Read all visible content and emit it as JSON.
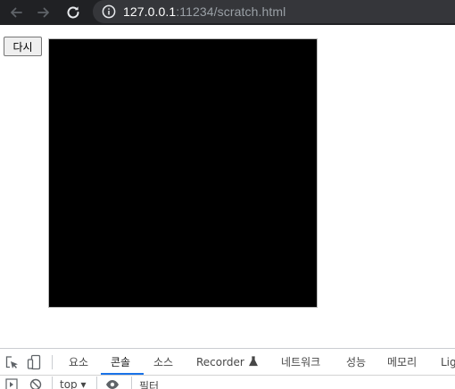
{
  "browser": {
    "url_host": "127.0.0.1",
    "url_rest": ":11234/scratch.html"
  },
  "page": {
    "retry_label": "다시"
  },
  "devtools": {
    "tabs": [
      "요소",
      "콘솔",
      "소스",
      "Recorder",
      "네트워크",
      "성능",
      "메모리",
      "Lig"
    ],
    "active_tab": "콘솔",
    "context": "top",
    "filter_placeholder": "필터"
  }
}
